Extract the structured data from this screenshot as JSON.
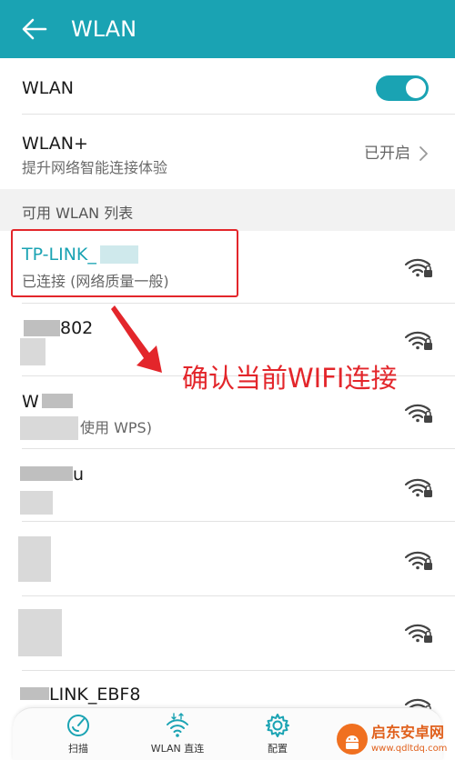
{
  "header": {
    "title": "WLAN"
  },
  "wlan": {
    "label": "WLAN",
    "enabled": true
  },
  "wlan_plus": {
    "label": "WLAN+",
    "subtitle": "提升网络智能连接体验",
    "status": "已开启"
  },
  "list": {
    "title": "可用 WLAN 列表",
    "networks": [
      {
        "name": "TP-LINK_",
        "subtitle": "已连接 (网络质量一般)",
        "connected": true
      },
      {
        "name": "802",
        "subtitle": ""
      },
      {
        "name": "W",
        "subtitle": "使用 WPS)"
      },
      {
        "name": "u",
        "subtitle": ""
      },
      {
        "name": "",
        "subtitle": ""
      },
      {
        "name": "",
        "subtitle": ""
      },
      {
        "name": "LINK_EBF8",
        "subtitle": ""
      }
    ]
  },
  "annotation": {
    "text": "确认当前WIFI连接"
  },
  "tabs": [
    {
      "label": "扫描",
      "icon": "scan-icon"
    },
    {
      "label": "WLAN 直连",
      "icon": "wifi-direct-icon"
    },
    {
      "label": "配置",
      "icon": "gear-icon"
    }
  ],
  "watermark": {
    "title": "启东安卓网",
    "url": "www.qdltdq.com"
  },
  "colors": {
    "accent": "#1aa3b3",
    "annotation": "#e3262b",
    "watermark": "#e0601c"
  }
}
